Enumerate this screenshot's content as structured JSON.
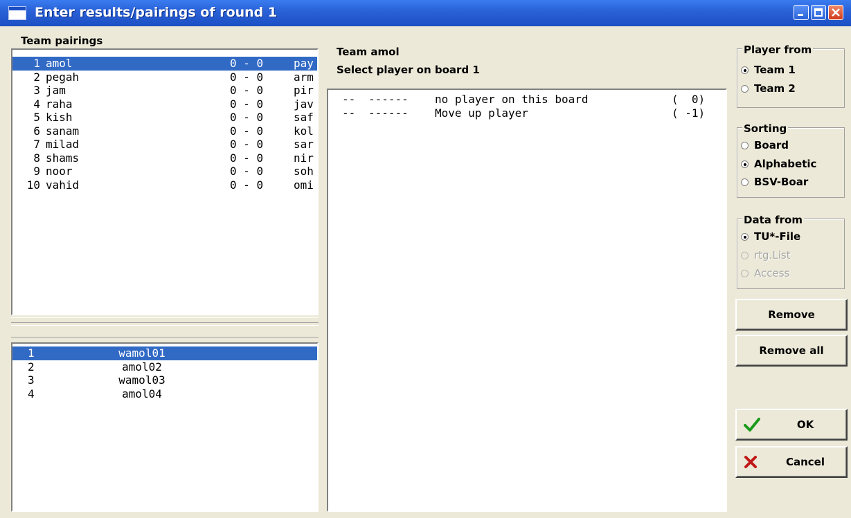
{
  "window": {
    "title": "Enter results/pairings of round 1"
  },
  "team_pairings": {
    "label": "Team pairings",
    "rows": [
      {
        "num": "1",
        "team": "amol",
        "score": "0 - 0",
        "opp": "pay"
      },
      {
        "num": "2",
        "team": "pegah",
        "score": "0 - 0",
        "opp": "arm"
      },
      {
        "num": "3",
        "team": "jam",
        "score": "0 - 0",
        "opp": "pir"
      },
      {
        "num": "4",
        "team": "raha",
        "score": "0 - 0",
        "opp": "jav"
      },
      {
        "num": "5",
        "team": "kish",
        "score": "0 - 0",
        "opp": "saf"
      },
      {
        "num": "6",
        "team": "sanam",
        "score": "0 - 0",
        "opp": "kol"
      },
      {
        "num": "7",
        "team": "milad",
        "score": "0 - 0",
        "opp": "sar"
      },
      {
        "num": "8",
        "team": "shams",
        "score": "0 - 0",
        "opp": "nir"
      },
      {
        "num": "9",
        "team": "noor",
        "score": "0 - 0",
        "opp": "soh"
      },
      {
        "num": "10",
        "team": "vahid",
        "score": "0 - 0",
        "opp": "omi"
      }
    ],
    "selected_index": 0
  },
  "boards": {
    "rows": [
      {
        "num": "1",
        "player": "wamol01"
      },
      {
        "num": "2",
        "player": "amol02"
      },
      {
        "num": "3",
        "player": "wamol03"
      },
      {
        "num": "4",
        "player": "amol04"
      }
    ],
    "selected_index": 0
  },
  "middle": {
    "team_line": "Team amol",
    "prompt": "Select player on board 1",
    "players": [
      {
        "id": "--",
        "code": "------",
        "name": "no player on this board",
        "rating": "(  0)"
      },
      {
        "id": "--",
        "code": "------",
        "name": "Move up player",
        "rating": "( -1)"
      }
    ]
  },
  "player_from": {
    "label": "Player from",
    "options": [
      "Team 1",
      "Team 2"
    ],
    "selected": "Team 1"
  },
  "sorting": {
    "label": "Sorting",
    "options": [
      "Board",
      "Alphabetic",
      "BSV-Boar"
    ],
    "selected": "Alphabetic"
  },
  "data_from": {
    "label": "Data from",
    "options": [
      "TU*-File",
      "rtg.List",
      "Access"
    ],
    "selected": "TU*-File",
    "disabled": [
      "rtg.List",
      "Access"
    ]
  },
  "buttons": {
    "remove": "Remove",
    "remove_all": "Remove all",
    "ok": "OK",
    "cancel": "Cancel"
  },
  "colors": {
    "titlebar": "#1c4fc4",
    "selection": "#316ac5",
    "face": "#ece9d8",
    "ok_check": "#1a9a1a",
    "cancel_x": "#c01818"
  }
}
